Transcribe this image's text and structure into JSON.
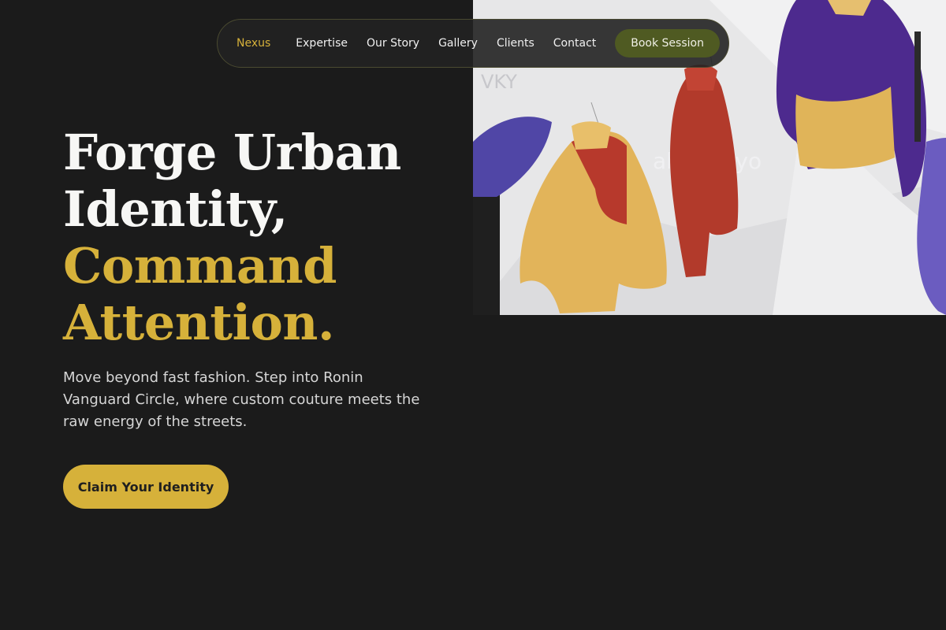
{
  "nav": {
    "links": [
      "Nexus",
      "Expertise",
      "Our Story",
      "Gallery",
      "Clients",
      "Contact"
    ],
    "cta_label": "Book Session"
  },
  "hero": {
    "headline_line1": "Forge Urban",
    "headline_line2": "Identity,",
    "headline_line3": "Command",
    "headline_line4": "Attention.",
    "lede": "Move beyond fast fashion. Step into Ronin Vanguard Circle, where custom couture meets the raw energy of the streets.",
    "cta_label": "Claim Your Identity",
    "image": {
      "subject": "garment-rack-photo",
      "sign_text": "abe.tokyo",
      "corner_text": "VKY"
    }
  },
  "colors": {
    "background": "#1b1b1b",
    "accent_gold": "#d6b13a",
    "nav_cta": "#4f5a22",
    "text_light": "#f2f2f2"
  }
}
